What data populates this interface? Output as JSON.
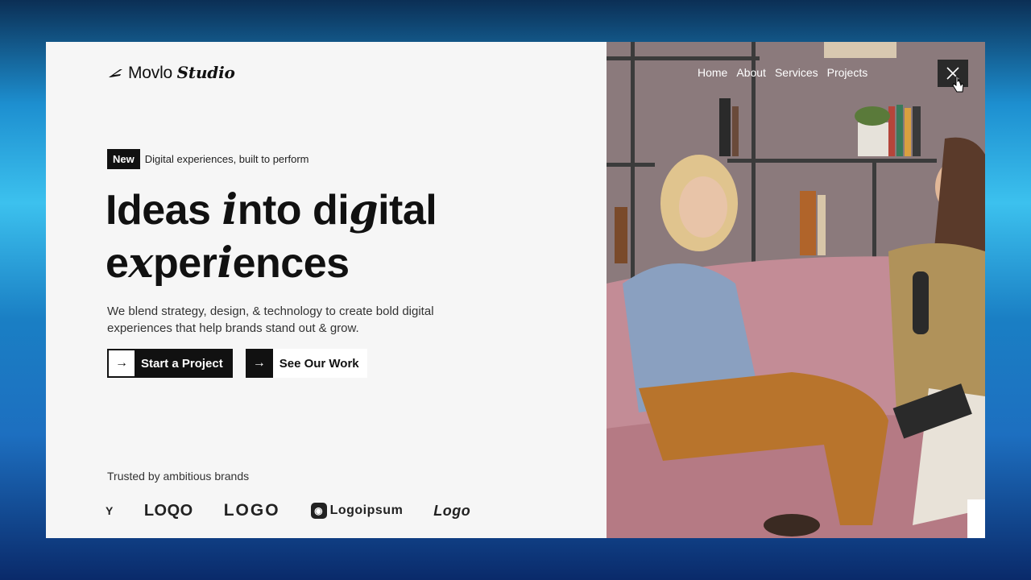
{
  "brand": {
    "name_plain": "Movlo",
    "name_italic": "Studio"
  },
  "hero": {
    "badge": "New",
    "badge_text": "Digital experiences, built to perform",
    "headline_line1_a": "Ideas ",
    "headline_line1_b": "i",
    "headline_line1_c": "nto di",
    "headline_line1_d": "g",
    "headline_line1_e": "ital",
    "headline_line2_a": "e",
    "headline_line2_b": "x",
    "headline_line2_c": "per",
    "headline_line2_d": "i",
    "headline_line2_e": "ences",
    "description": "We blend strategy, design, & technology to create bold digital experiences that help brands stand out & grow.",
    "primary_cta": "Start a Project",
    "secondary_cta": "See Our Work"
  },
  "trusted": {
    "label": "Trusted by ambitious brands",
    "logos": [
      "Y",
      "LOQO",
      "LOGO",
      "Logoipsum",
      "Logo"
    ]
  },
  "nav": {
    "items": [
      "Home",
      "About",
      "Services",
      "Projects"
    ]
  },
  "icons": {
    "close": "close-icon",
    "arrow": "arrow-right-icon",
    "logo": "logo-mark-icon"
  }
}
